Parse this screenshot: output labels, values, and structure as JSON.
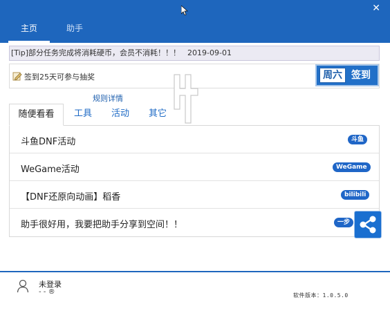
{
  "window": {
    "close_glyph": "✕"
  },
  "nav": {
    "tabs": [
      {
        "label": "主页",
        "active": true
      },
      {
        "label": "助手",
        "active": false
      }
    ]
  },
  "tip": {
    "text": "[Tip]部分任务完成将消耗硬币，会员不消耗！！！",
    "date": "2019-09-01"
  },
  "signin": {
    "text": "签到25天可参与抽奖",
    "day": "周六",
    "button_label": "签到",
    "rules_link": "规则详情"
  },
  "content_tabs": [
    {
      "label": "随便看看",
      "active": true
    },
    {
      "label": "工具",
      "active": false
    },
    {
      "label": "活动",
      "active": false
    },
    {
      "label": "其它",
      "active": false
    }
  ],
  "list": [
    {
      "label": "斗鱼DNF活动",
      "badge": "斗鱼"
    },
    {
      "label": "WeGame活动",
      "badge": "WeGame"
    },
    {
      "label": "【DNF还原向动画】稻香",
      "badge": "bilibili"
    },
    {
      "label": "助手很好用，我要把助手分享到空间！！",
      "badge": "一步"
    }
  ],
  "footer": {
    "login_label": "未登录",
    "login_sub": "- - ®",
    "version": "软件版本：1.0.5.0"
  },
  "colors": {
    "header": "#1e66bd",
    "badge": "#1f66c7",
    "tab_link": "#1e6ac5"
  },
  "icons": {
    "close": "close-icon",
    "sign": "pencil-note-icon",
    "share": "share-icon",
    "user": "user-icon",
    "logo": "logo-icon"
  }
}
